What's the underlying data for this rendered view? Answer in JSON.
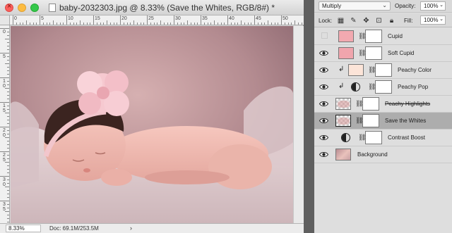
{
  "document": {
    "title": "baby-2032303.jpg @ 8.33% (Save the Whites, RGB/8#) *",
    "zoom": "8.33%",
    "doc_size": "Doc: 69.1M/253.5M",
    "status_arrow": "›",
    "ruler_top_labels": [
      "0",
      "5",
      "10",
      "15",
      "20",
      "25",
      "30",
      "35",
      "40",
      "45",
      "50"
    ],
    "ruler_left_labels": [
      "0",
      "5",
      "1\n0",
      "1\n5",
      "2\n0",
      "2\n5",
      "3\n0",
      "3\n5"
    ]
  },
  "layers_panel": {
    "blend_mode": "Multiply",
    "opacity_label": "Opacity:",
    "opacity_value": "100%",
    "lock_label": "Lock:",
    "fill_label": "Fill:",
    "fill_value": "100%",
    "layers": [
      {
        "name": "Cupid",
        "visible": false,
        "type": "color-fill",
        "swatch": "#f2a9b0",
        "clipped": false,
        "selected": false,
        "strike": false
      },
      {
        "name": "Soft Cupid",
        "visible": true,
        "type": "color-fill",
        "swatch": "#f0a5ad",
        "clipped": false,
        "selected": false,
        "strike": false
      },
      {
        "name": "Peachy Color",
        "visible": true,
        "type": "color-fill",
        "swatch": "#fce4d8",
        "clipped": true,
        "selected": false,
        "strike": false
      },
      {
        "name": "Peachy Pop",
        "visible": true,
        "type": "adjustment",
        "clipped": true,
        "selected": false,
        "strike": false
      },
      {
        "name": "Peachy Highlights",
        "visible": true,
        "type": "pixel",
        "clipped": false,
        "selected": false,
        "strike": true
      },
      {
        "name": "Save the Whites",
        "visible": true,
        "type": "pixel",
        "clipped": false,
        "selected": true,
        "strike": false
      },
      {
        "name": "Contrast Boost",
        "visible": true,
        "type": "adjustment",
        "clipped": false,
        "selected": false,
        "strike": false
      },
      {
        "name": "Background",
        "visible": true,
        "type": "image",
        "clipped": false,
        "selected": false,
        "strike": false
      }
    ]
  },
  "icons": {
    "close": "close-icon",
    "eye": "eye-icon",
    "chain": "link-icon",
    "lock": "lock-icon"
  }
}
